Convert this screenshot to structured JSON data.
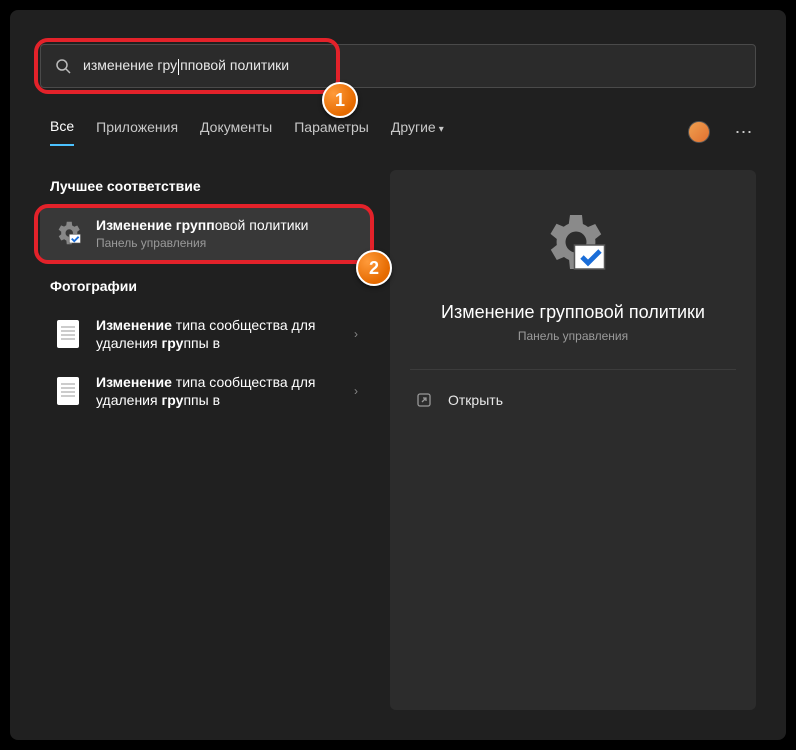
{
  "search": {
    "query_before_cursor": "изменение гру",
    "query_after_cursor": "пповой политики"
  },
  "tabs": {
    "all": "Все",
    "apps": "Приложения",
    "docs": "Документы",
    "settings": "Параметры",
    "more": "Другие"
  },
  "sections": {
    "best_match": "Лучшее соответствие",
    "photos": "Фотографии"
  },
  "best_match": {
    "title_html": "<b>Изменение групп</b>овой политики",
    "subtitle": "Панель управления"
  },
  "photo_results": [
    {
      "title_html": "<b>Изменение</b> типа сообщества для удаления <b>гру</b>ппы в"
    },
    {
      "title_html": "<b>Изменение</b> типа сообщества для удаления <b>гру</b>ппы в"
    }
  ],
  "detail": {
    "title": "Изменение групповой политики",
    "subtitle": "Панель управления",
    "open": "Открыть"
  },
  "annotations": {
    "badge1": "1",
    "badge2": "2"
  }
}
